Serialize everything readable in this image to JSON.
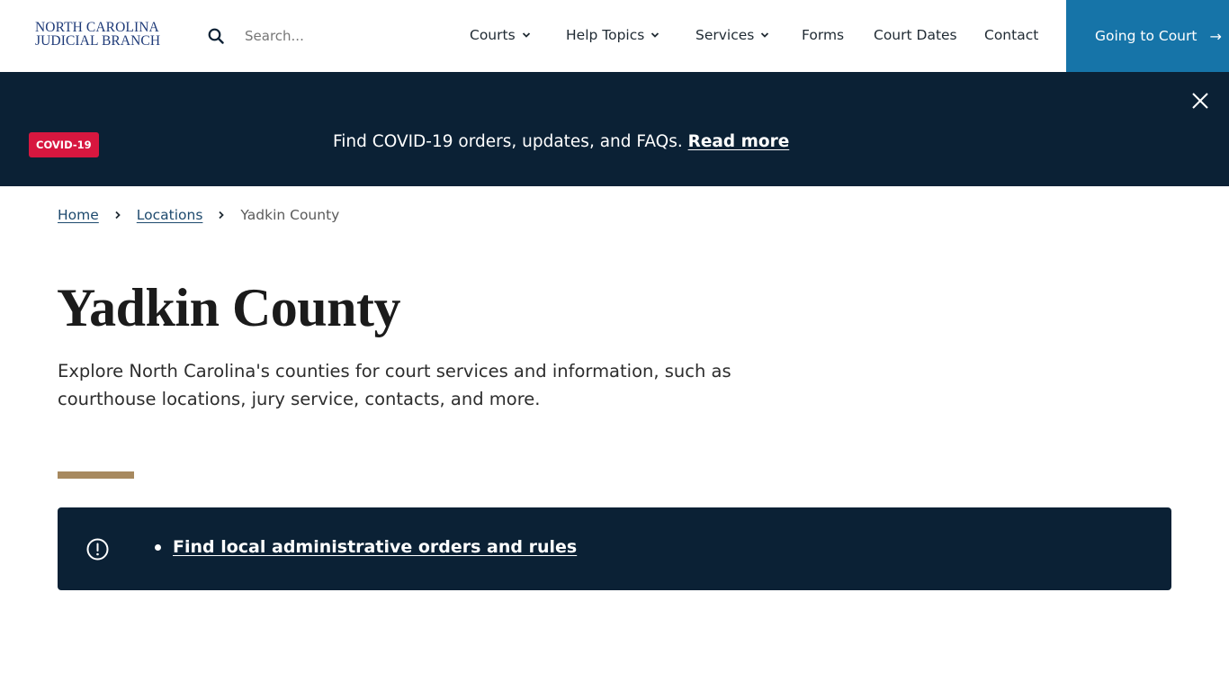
{
  "header": {
    "logo_line1": "NORTH CAROLINA",
    "logo_line2": "JUDICIAL BRANCH",
    "search": {
      "placeholder": "Search...",
      "value": "",
      "icon": "search-icon"
    },
    "nav": [
      {
        "label": "Courts",
        "has_dropdown": true
      },
      {
        "label": "Help Topics",
        "has_dropdown": true
      },
      {
        "label": "Services",
        "has_dropdown": true
      },
      {
        "label": "Forms",
        "has_dropdown": false
      },
      {
        "label": "Court Dates",
        "has_dropdown": false
      },
      {
        "label": "Contact",
        "has_dropdown": false
      }
    ],
    "cta": {
      "label": "Going to Court",
      "icon": "arrow-right-icon",
      "color": "#1674a8"
    }
  },
  "alert_banner": {
    "badge": "COVID-19",
    "badge_color": "#d7173f",
    "text": "Find COVID-19 orders, updates, and FAQs.",
    "link_label": "Read more",
    "close_icon": "close-icon",
    "background": "#0b2135"
  },
  "breadcrumb": {
    "items": [
      {
        "label": "Home",
        "link": true
      },
      {
        "label": "Locations",
        "link": true
      },
      {
        "label": "Yadkin County",
        "link": false
      }
    ]
  },
  "main": {
    "title": "Yadkin County",
    "intro": "Explore North Carolina's counties for court services and information, such as courthouse locations, jury service, contacts, and more.",
    "accent_color": "#a7895f",
    "info_box": {
      "icon": "exclamation-circle-icon",
      "links": [
        {
          "label": "Find local administrative orders and rules"
        }
      ]
    }
  }
}
